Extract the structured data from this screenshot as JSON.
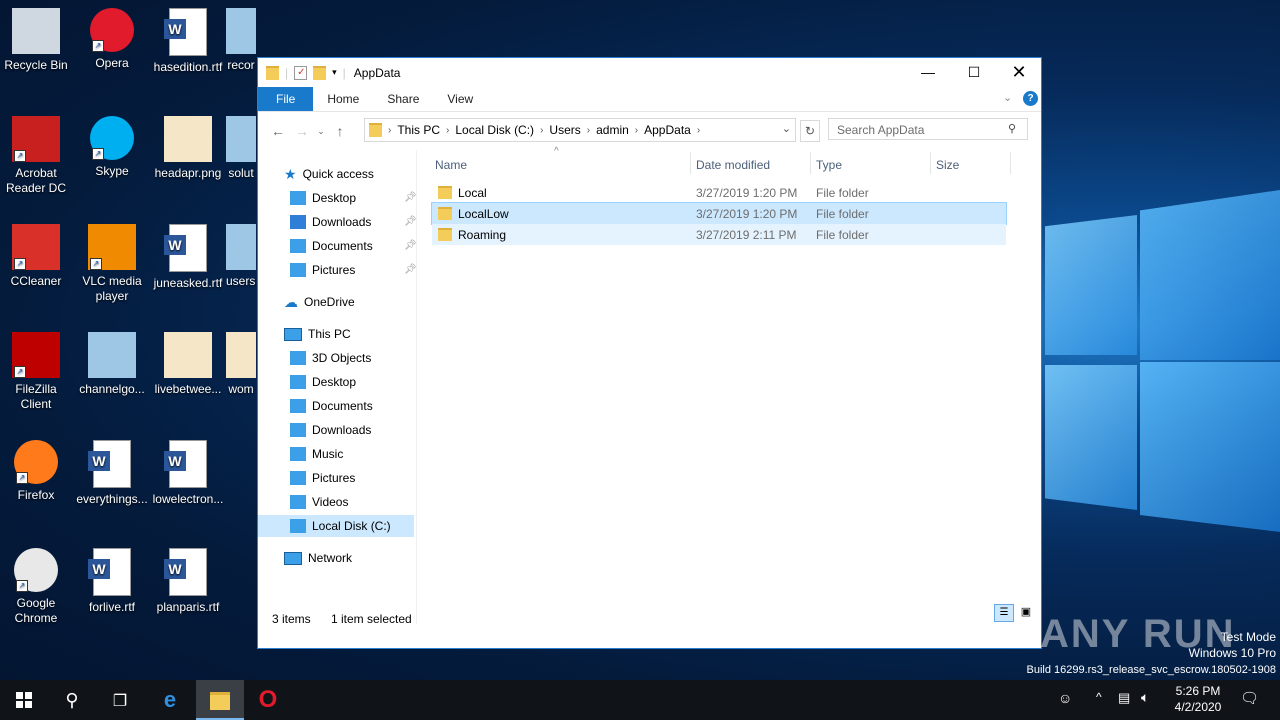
{
  "desktop": {
    "icons": [
      {
        "label": "Recycle Bin",
        "name": "recycle-bin-icon"
      },
      {
        "label": "Opera",
        "name": "opera-icon"
      },
      {
        "label": "hasedition.rtf",
        "name": "word-doc-icon"
      },
      {
        "label": "recor",
        "name": "image-file-icon"
      },
      {
        "label": "Acrobat\nReader DC",
        "name": "acrobat-icon"
      },
      {
        "label": "Skype",
        "name": "skype-icon"
      },
      {
        "label": "headapr.png",
        "name": "png-image-icon"
      },
      {
        "label": "solut",
        "name": "image-file-icon"
      },
      {
        "label": "CCleaner",
        "name": "ccleaner-icon"
      },
      {
        "label": "VLC media\nplayer",
        "name": "vlc-icon"
      },
      {
        "label": "juneasked.rtf",
        "name": "word-doc-icon"
      },
      {
        "label": "usersr",
        "name": "image-file-icon"
      },
      {
        "label": "FileZilla\nClient",
        "name": "filezilla-icon"
      },
      {
        "label": "channelgo...",
        "name": "image-file-icon"
      },
      {
        "label": "livebetwee...",
        "name": "png-image-icon"
      },
      {
        "label": "wom",
        "name": "png-image-icon"
      },
      {
        "label": "Firefox",
        "name": "firefox-icon"
      },
      {
        "label": "everythings...",
        "name": "word-doc-icon"
      },
      {
        "label": "lowelectron...",
        "name": "word-doc-icon"
      },
      {
        "label": "Google\nChrome",
        "name": "chrome-icon"
      },
      {
        "label": "forlive.rtf",
        "name": "word-doc-icon"
      },
      {
        "label": "planparis.rtf",
        "name": "word-doc-icon"
      }
    ]
  },
  "window": {
    "title": "AppData",
    "ribbon_tabs": [
      "File",
      "Home",
      "Share",
      "View"
    ],
    "breadcrumbs": [
      "This PC",
      "Local Disk (C:)",
      "Users",
      "admin",
      "AppData"
    ],
    "search_placeholder": "Search AppData",
    "nav": {
      "quick_access": "Quick access",
      "qa_items": [
        "Desktop",
        "Downloads",
        "Documents",
        "Pictures"
      ],
      "onedrive": "OneDrive",
      "this_pc": "This PC",
      "pc_items": [
        "3D Objects",
        "Desktop",
        "Documents",
        "Downloads",
        "Music",
        "Pictures",
        "Videos",
        "Local Disk (C:)"
      ],
      "network": "Network"
    },
    "columns": [
      "Name",
      "Date modified",
      "Type",
      "Size"
    ],
    "rows": [
      {
        "name": "Local",
        "date": "3/27/2019 1:20 PM",
        "type": "File folder"
      },
      {
        "name": "LocalLow",
        "date": "3/27/2019 1:20 PM",
        "type": "File folder"
      },
      {
        "name": "Roaming",
        "date": "3/27/2019 2:11 PM",
        "type": "File folder"
      }
    ],
    "status_items": "3 items",
    "status_selected": "1 item selected"
  },
  "watermark": {
    "line1": "Test Mode",
    "line2": "Windows 10 Pro",
    "line3": "Build 16299.rs3_release_svc_escrow.180502-1908",
    "brand": "ANY RUN"
  },
  "taskbar": {
    "time": "5:26 PM",
    "date": "4/2/2020"
  },
  "colors": {
    "accent": "#1979ca",
    "selection": "#cce8ff",
    "taskbar": "#101418"
  }
}
